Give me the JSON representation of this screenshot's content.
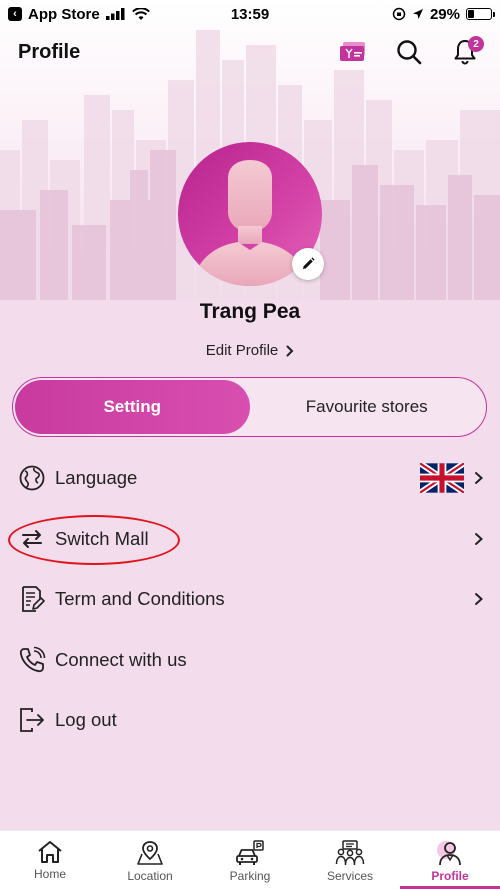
{
  "status_bar": {
    "back_app": "App Store",
    "time": "13:59",
    "battery_percent": "29%",
    "battery_level": 0.29
  },
  "header": {
    "title": "Profile",
    "notification_count": "2",
    "icons": [
      "gift-card-icon",
      "search-icon",
      "bell-icon"
    ]
  },
  "profile": {
    "name": "Trang Pea",
    "edit_label": "Edit Profile"
  },
  "tabs": [
    {
      "label": "Setting",
      "active": true
    },
    {
      "label": "Favourite stores",
      "active": false
    }
  ],
  "menu": [
    {
      "label": "Language",
      "icon": "globe-icon",
      "has_chevron": true,
      "has_flag": true
    },
    {
      "label": "Switch Mall",
      "icon": "switch-arrows-icon",
      "has_chevron": true,
      "highlighted": true
    },
    {
      "label": "Term and Conditions",
      "icon": "document-edit-icon",
      "has_chevron": true
    },
    {
      "label": "Connect with us",
      "icon": "phone-icon",
      "has_chevron": false
    },
    {
      "label": "Log out",
      "icon": "logout-icon",
      "has_chevron": false
    }
  ],
  "bottom_nav": [
    {
      "label": "Home",
      "icon": "home-icon",
      "active": false
    },
    {
      "label": "Location",
      "icon": "map-pin-icon",
      "active": false
    },
    {
      "label": "Parking",
      "icon": "car-parking-icon",
      "active": false
    },
    {
      "label": "Services",
      "icon": "services-icon",
      "active": false
    },
    {
      "label": "Profile",
      "icon": "user-icon",
      "active": true
    }
  ],
  "colors": {
    "accent": "#c2349c",
    "background": "#f3dcec",
    "highlight_ring": "#e0141d"
  }
}
